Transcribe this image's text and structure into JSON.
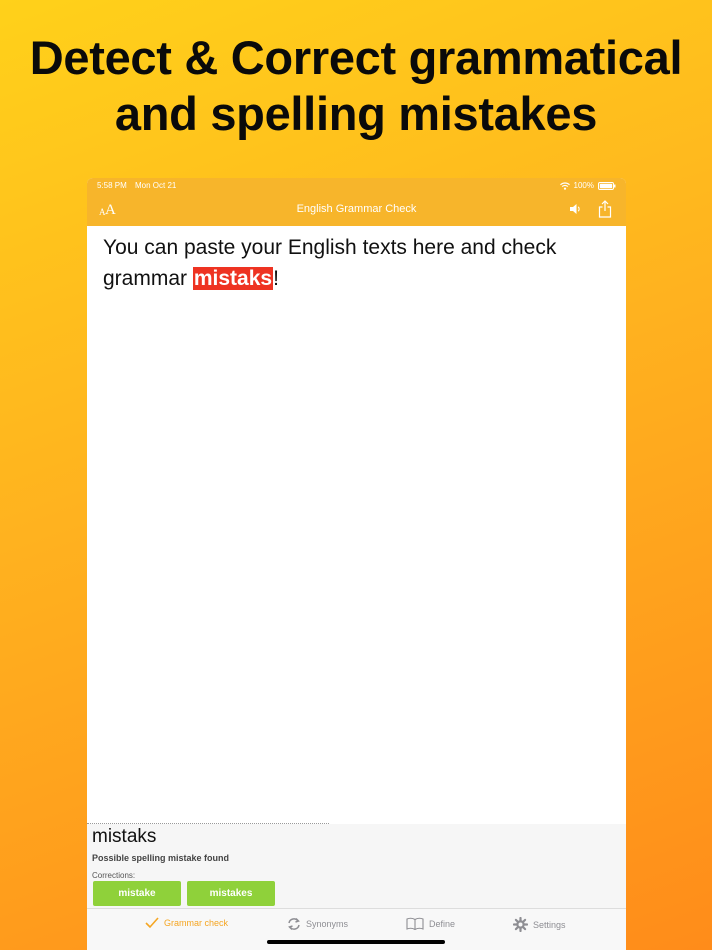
{
  "headline": {
    "line1": "Detect & Correct grammatical",
    "line2": "and spelling mistakes"
  },
  "status_bar": {
    "time": "5:58 PM",
    "date": "Mon Oct 21",
    "battery": "100%"
  },
  "navbar": {
    "title": "English Grammar Check",
    "left_icon": "font-size-icon",
    "right_icons": [
      "speaker-icon",
      "share-icon"
    ]
  },
  "editor": {
    "text_before": "You can paste your English texts here and check grammar ",
    "highlighted_word": "mistaks",
    "text_after": "!"
  },
  "correction_panel": {
    "word": "mistaks",
    "description": "Possible spelling mistake found",
    "corrections_label": "Corrections:",
    "suggestions": [
      "mistake",
      "mistakes"
    ]
  },
  "tabbar": {
    "tabs": [
      {
        "label": "Grammar check",
        "icon": "checkmark-icon",
        "active": true
      },
      {
        "label": "Synonyms",
        "icon": "sync-icon",
        "active": false
      },
      {
        "label": "Define",
        "icon": "book-icon",
        "active": false
      },
      {
        "label": "Settings",
        "icon": "gear-icon",
        "active": false
      }
    ]
  },
  "colors": {
    "accent": "#f7b52b",
    "error_highlight": "#ee3322",
    "suggestion_button": "#8fd13a",
    "active_tab": "#f5a623"
  }
}
